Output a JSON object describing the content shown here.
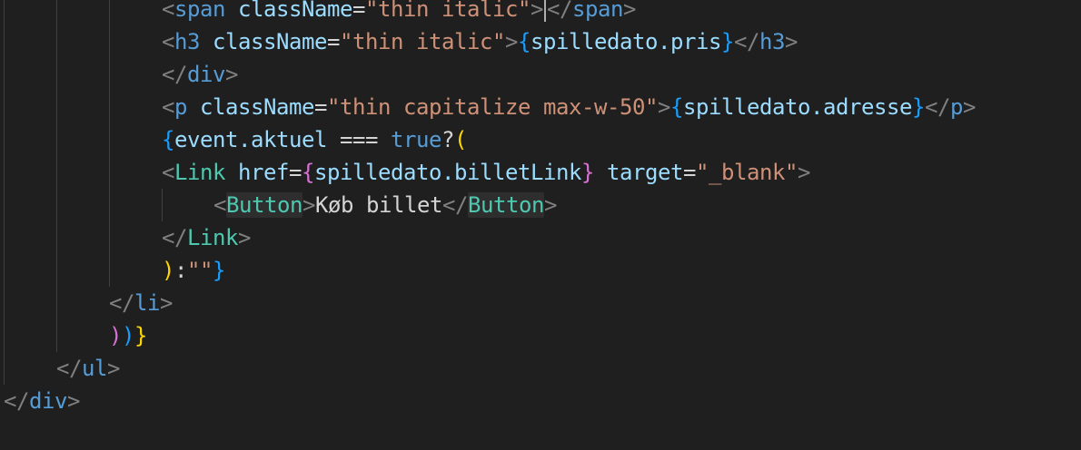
{
  "editor": {
    "lines": [
      {
        "tokens": [
          {
            "t": "<",
            "c": "tag-bracket"
          },
          {
            "t": "span",
            "c": "tag-html"
          },
          {
            "t": " ",
            "c": "text"
          },
          {
            "t": "className",
            "c": "attr"
          },
          {
            "t": "=",
            "c": "text"
          },
          {
            "t": "\"thin italic\"",
            "c": "str"
          },
          {
            "t": ">",
            "c": "tag-bracket"
          },
          {
            "cursor": true
          },
          {
            "t": "</",
            "c": "tag-bracket"
          },
          {
            "t": "span",
            "c": "tag-html"
          },
          {
            "t": ">",
            "c": "tag-bracket"
          }
        ]
      },
      {
        "tokens": [
          {
            "t": "<",
            "c": "tag-bracket"
          },
          {
            "t": "h3",
            "c": "tag-html"
          },
          {
            "t": " ",
            "c": "text"
          },
          {
            "t": "className",
            "c": "attr"
          },
          {
            "t": "=",
            "c": "text"
          },
          {
            "t": "\"thin italic\"",
            "c": "str"
          },
          {
            "t": ">",
            "c": "tag-bracket"
          },
          {
            "t": "{",
            "c": "brace-b"
          },
          {
            "t": "spilledato.pris",
            "c": "var"
          },
          {
            "t": "}",
            "c": "brace-b"
          },
          {
            "t": "</",
            "c": "tag-bracket"
          },
          {
            "t": "h3",
            "c": "tag-html"
          },
          {
            "t": ">",
            "c": "tag-bracket"
          }
        ]
      },
      {
        "tokens": [
          {
            "t": "</",
            "c": "tag-bracket"
          },
          {
            "t": "div",
            "c": "tag-html"
          },
          {
            "t": ">",
            "c": "tag-bracket"
          }
        ]
      },
      {
        "tokens": [
          {
            "t": "<",
            "c": "tag-bracket"
          },
          {
            "t": "p",
            "c": "tag-html"
          },
          {
            "t": " ",
            "c": "text"
          },
          {
            "t": "className",
            "c": "attr"
          },
          {
            "t": "=",
            "c": "text"
          },
          {
            "t": "\"thin capitalize max-w-50\"",
            "c": "str"
          },
          {
            "t": ">",
            "c": "tag-bracket"
          },
          {
            "t": "{",
            "c": "brace-b"
          },
          {
            "t": "spilledato.adresse",
            "c": "var"
          },
          {
            "t": "}",
            "c": "brace-b"
          },
          {
            "t": "</",
            "c": "tag-bracket"
          },
          {
            "t": "p",
            "c": "tag-html"
          },
          {
            "t": ">",
            "c": "tag-bracket"
          }
        ]
      },
      {
        "tokens": [
          {
            "t": "{",
            "c": "brace-b"
          },
          {
            "t": "event.aktuel",
            "c": "var"
          },
          {
            "t": " === ",
            "c": "text"
          },
          {
            "t": "true",
            "c": "kw"
          },
          {
            "t": "?",
            "c": "text"
          },
          {
            "t": "(",
            "c": "brace-y"
          }
        ]
      },
      {
        "tokens": [
          {
            "t": "<",
            "c": "tag-bracket"
          },
          {
            "t": "Link",
            "c": "tag-comp"
          },
          {
            "t": " ",
            "c": "text"
          },
          {
            "t": "href",
            "c": "attr"
          },
          {
            "t": "=",
            "c": "text"
          },
          {
            "t": "{",
            "c": "brace-p"
          },
          {
            "t": "spilledato.billetLink",
            "c": "var"
          },
          {
            "t": "}",
            "c": "brace-p"
          },
          {
            "t": " ",
            "c": "text"
          },
          {
            "t": "target",
            "c": "attr"
          },
          {
            "t": "=",
            "c": "text"
          },
          {
            "t": "\"_blank\"",
            "c": "str"
          },
          {
            "t": ">",
            "c": "tag-bracket"
          }
        ]
      },
      {
        "tokens": [
          {
            "t": "<",
            "c": "tag-bracket"
          },
          {
            "t": "Button",
            "c": "tag-comp hl"
          },
          {
            "t": ">",
            "c": "tag-bracket"
          },
          {
            "t": "Køb billet",
            "c": "text"
          },
          {
            "t": "</",
            "c": "tag-bracket"
          },
          {
            "t": "Button",
            "c": "tag-comp hl"
          },
          {
            "t": ">",
            "c": "tag-bracket"
          }
        ]
      },
      {
        "tokens": [
          {
            "t": "</",
            "c": "tag-bracket"
          },
          {
            "t": "Link",
            "c": "tag-comp"
          },
          {
            "t": ">",
            "c": "tag-bracket"
          }
        ]
      },
      {
        "tokens": [
          {
            "t": ")",
            "c": "brace-y"
          },
          {
            "t": ":",
            "c": "text"
          },
          {
            "t": "\"\"",
            "c": "str"
          },
          {
            "t": "}",
            "c": "brace-b"
          }
        ]
      },
      {
        "tokens": [
          {
            "t": "</",
            "c": "tag-bracket"
          },
          {
            "t": "li",
            "c": "tag-html"
          },
          {
            "t": ">",
            "c": "tag-bracket"
          }
        ]
      },
      {
        "tokens": [
          {
            "t": ")",
            "c": "brace-p"
          },
          {
            "t": ")",
            "c": "brace-b"
          },
          {
            "t": "}",
            "c": "brace-y"
          }
        ]
      },
      {
        "tokens": [
          {
            "t": "</",
            "c": "tag-bracket"
          },
          {
            "t": "ul",
            "c": "tag-html"
          },
          {
            "t": ">",
            "c": "tag-bracket"
          }
        ]
      },
      {
        "tokens": [
          {
            "t": "</",
            "c": "tag-bracket"
          },
          {
            "t": "div",
            "c": "tag-html"
          },
          {
            "t": ">",
            "c": "tag-bracket"
          }
        ]
      }
    ]
  }
}
